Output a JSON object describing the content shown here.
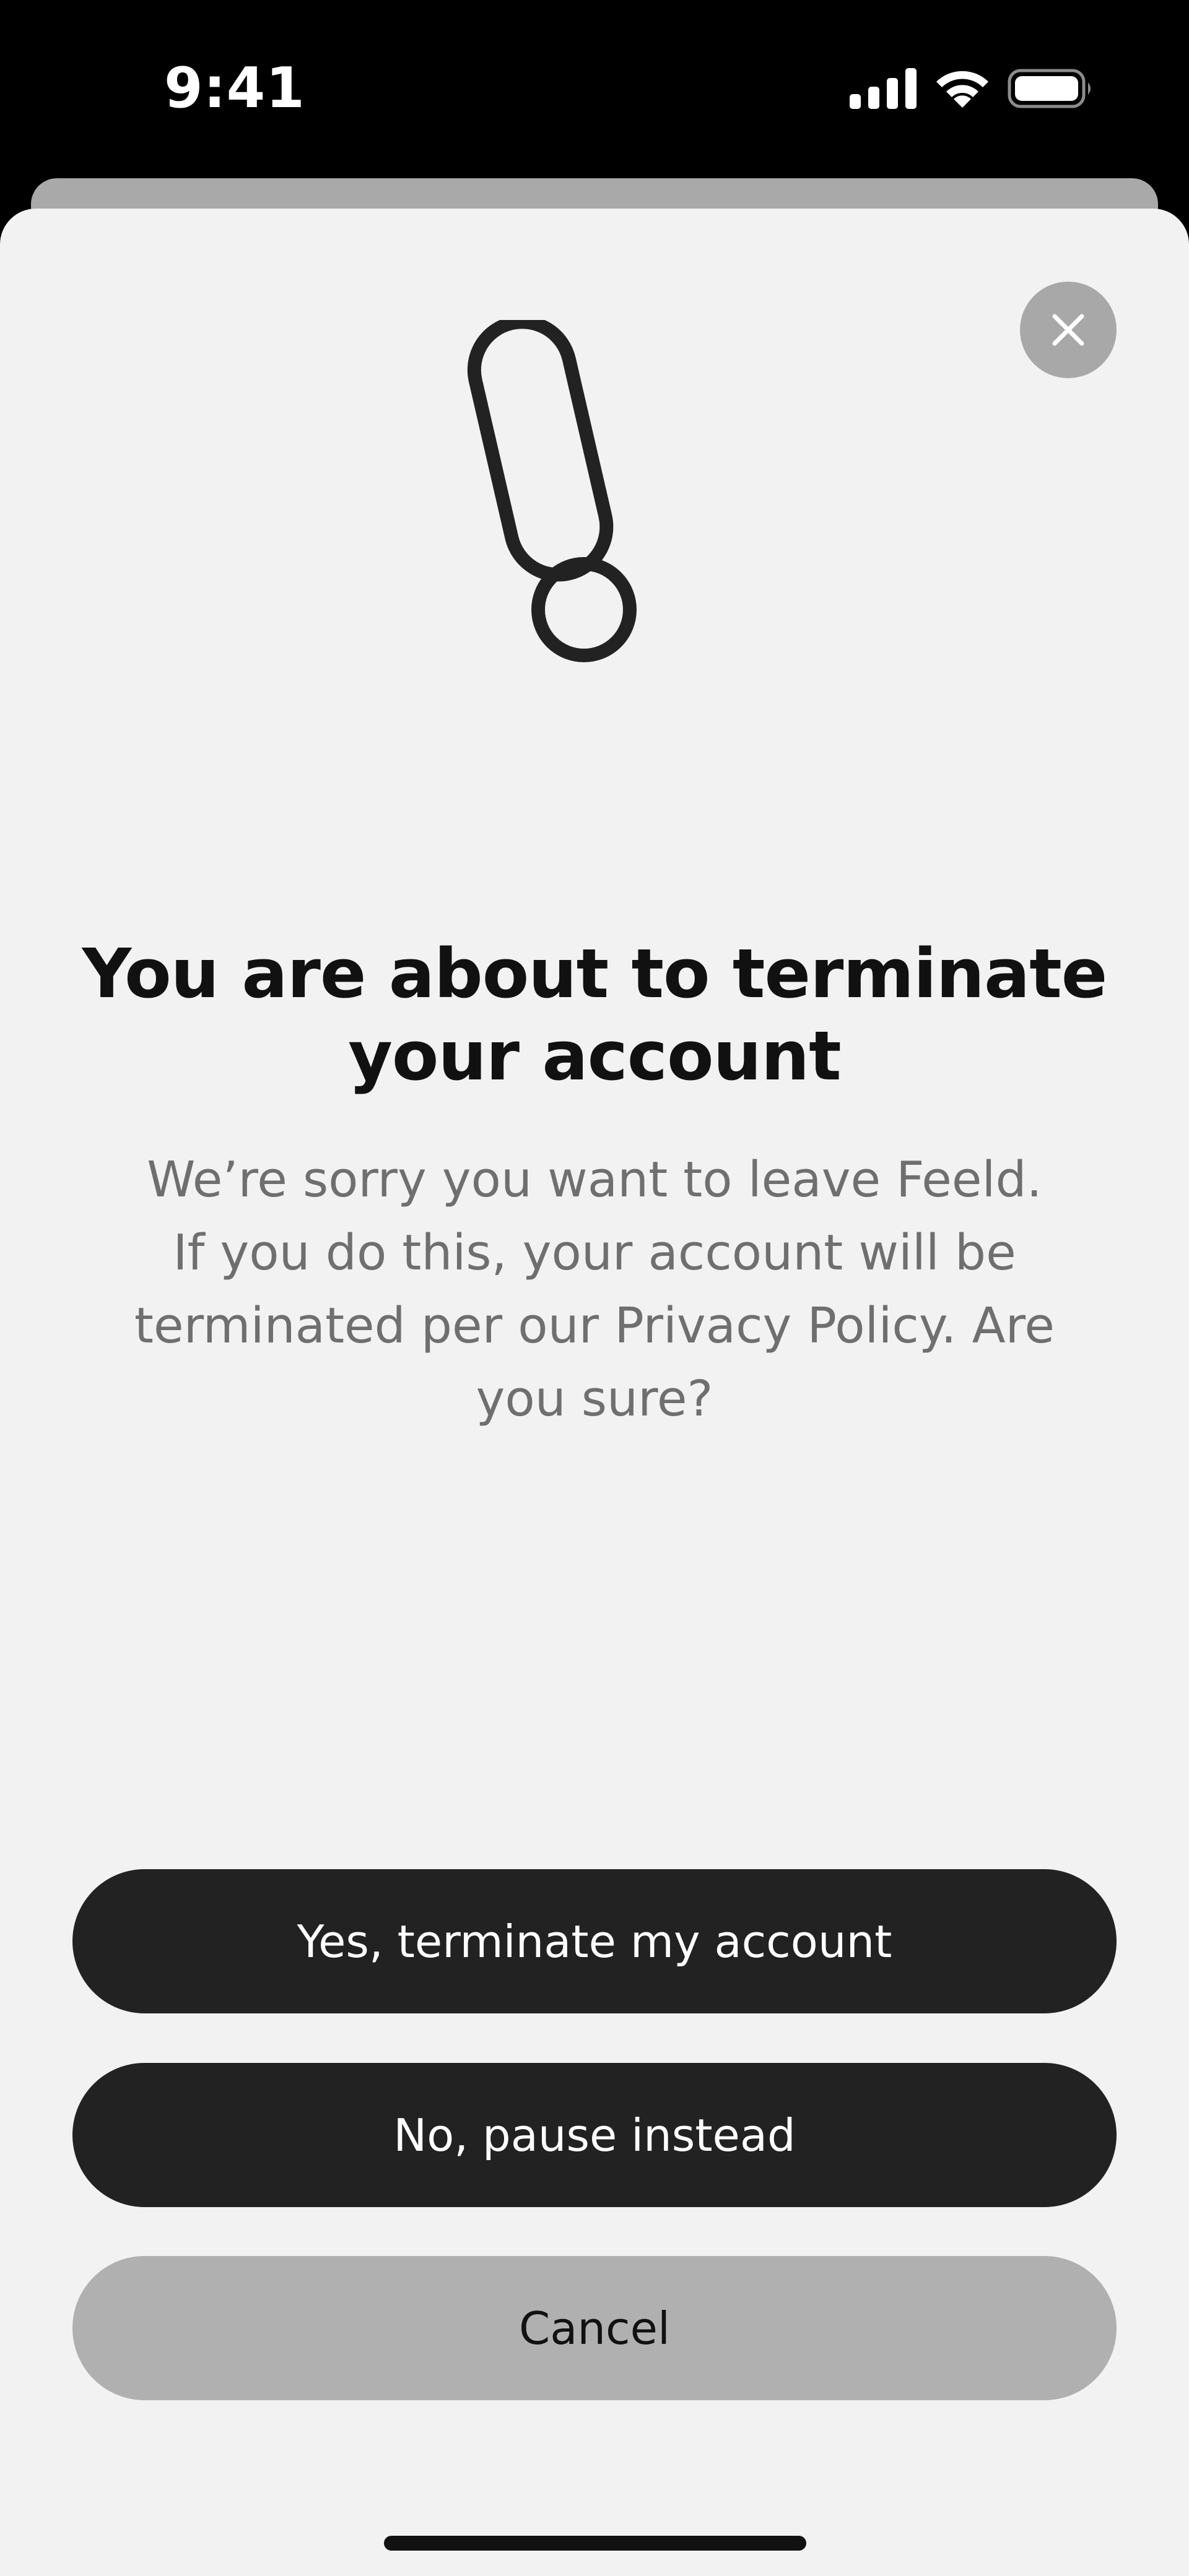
{
  "status_bar": {
    "time": "9:41",
    "icons": [
      "cellular-signal-icon",
      "wifi-icon",
      "battery-icon"
    ]
  },
  "dialog": {
    "close_icon": "close-icon",
    "graphic_icon": "exclamation-icon",
    "title": "You are about to terminate your account",
    "body": "We’re sorry you want to leave Feeld. If you do this, your account will be terminated per our Privacy Policy. Are you sure?",
    "buttons": {
      "terminate": "Yes, terminate my account",
      "pause": "No, pause instead",
      "cancel": "Cancel"
    }
  },
  "colors": {
    "sheet_background": "#f2f2f2",
    "primary_button": "#222222",
    "secondary_button": "#b0b0b0",
    "close_button": "#a8a8a8",
    "body_text": "#6f6f6f"
  }
}
